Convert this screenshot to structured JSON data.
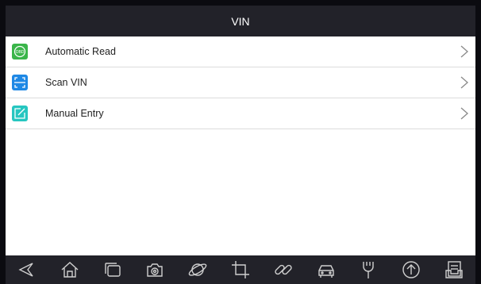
{
  "header": {
    "title": "VIN"
  },
  "menu": {
    "items": [
      {
        "label": "Automatic Read",
        "icon": "obd-icon",
        "icon_color": "#3ab54a",
        "icon_text": "OBD"
      },
      {
        "label": "Scan VIN",
        "icon": "scan-icon",
        "icon_color": "#1e88e5"
      },
      {
        "label": "Manual Entry",
        "icon": "edit-icon",
        "icon_color": "#26c6c0"
      }
    ]
  },
  "navbar": {
    "icons": [
      "back-icon",
      "home-icon",
      "recent-apps-icon",
      "camera-icon",
      "browser-icon",
      "crop-icon",
      "link-icon",
      "car-icon",
      "wrench-icon",
      "upload-icon",
      "report-icon"
    ]
  },
  "colors": {
    "bar": "#222229",
    "divider": "#dcdcdc"
  }
}
